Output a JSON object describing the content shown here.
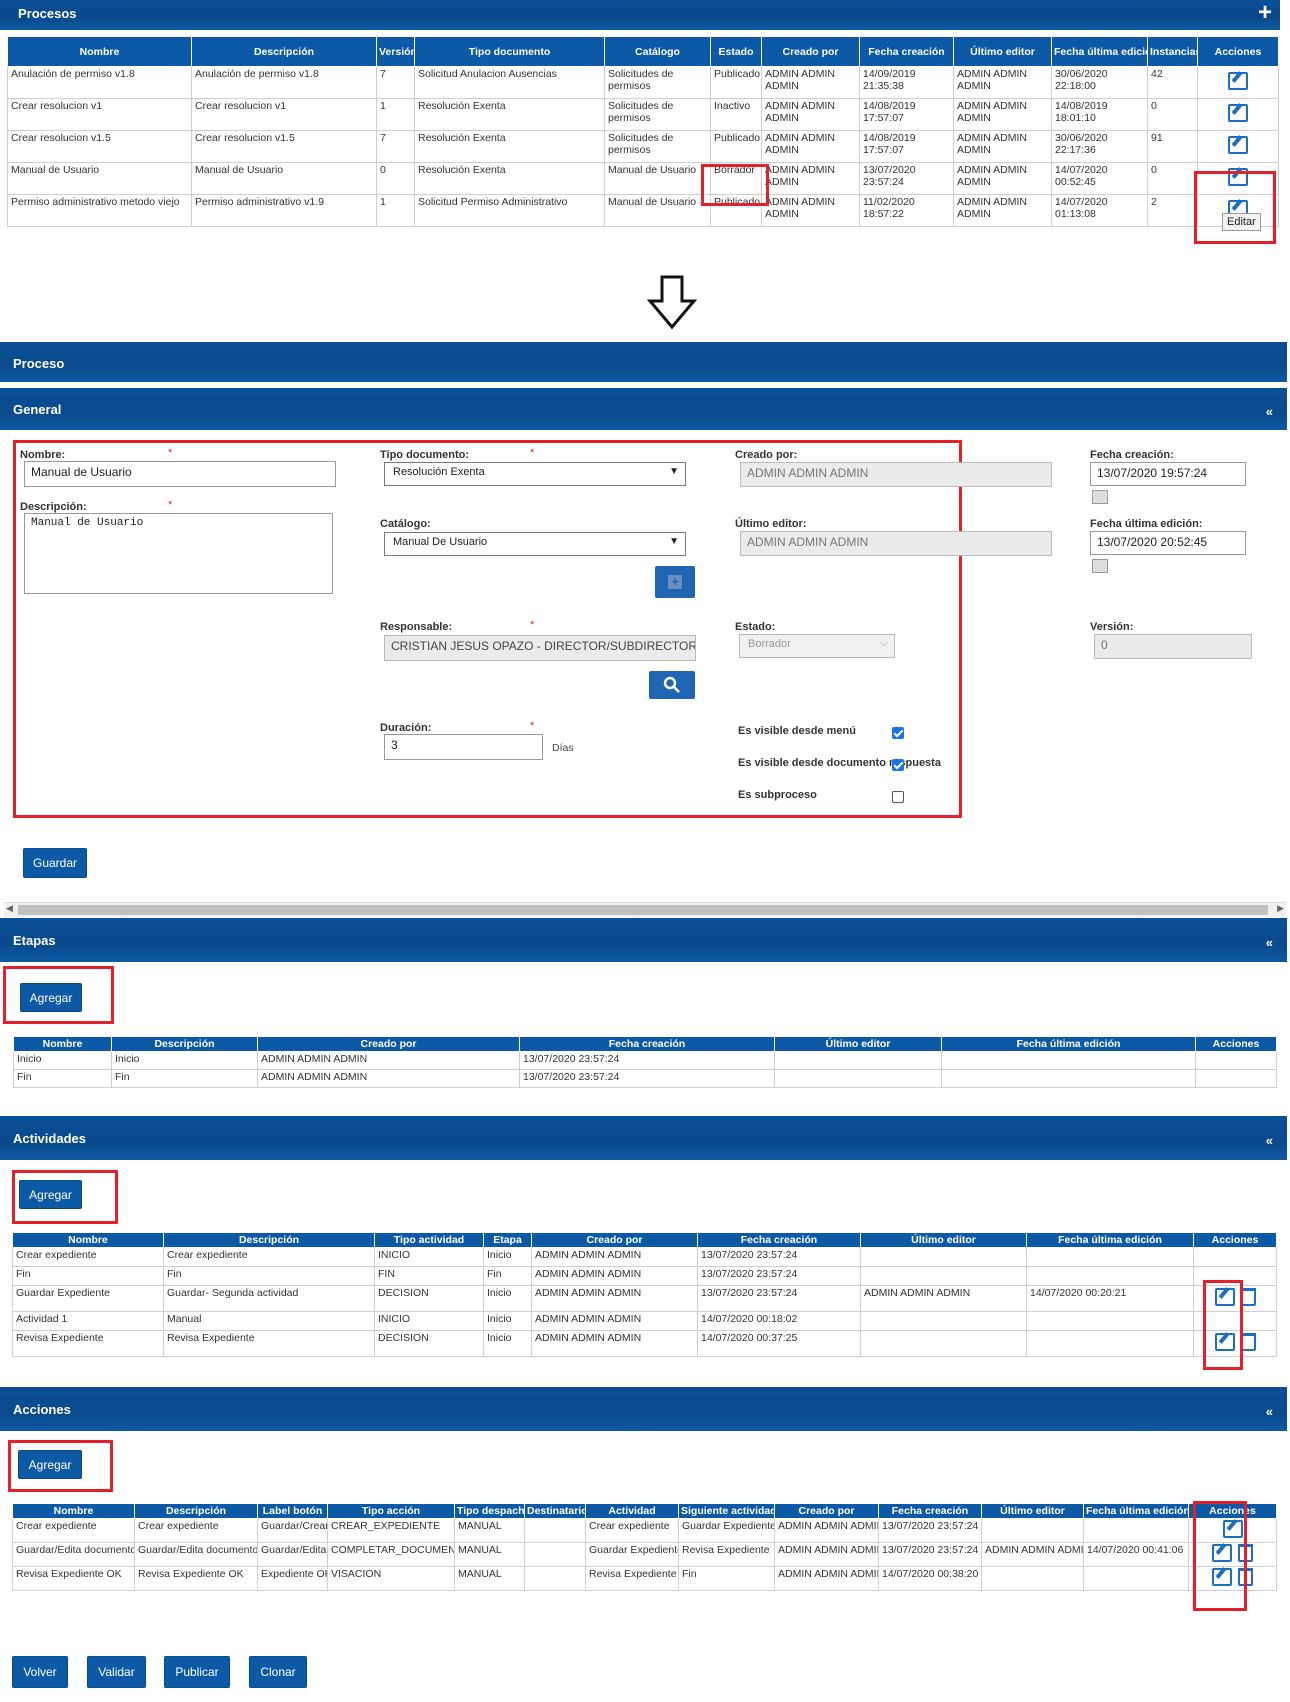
{
  "procesos": {
    "title": "Procesos",
    "add_icon": "plus-icon",
    "columns": [
      "Nombre",
      "Descripción",
      "Versión",
      "Tipo documento",
      "Catálogo",
      "Estado",
      "Creado por",
      "Fecha creación",
      "Último editor",
      "Fecha última edición",
      "Instancias",
      "Acciones"
    ],
    "rows": [
      [
        "Anulación de permiso v1.8",
        "Anulación de permiso v1.8",
        "7",
        "Solicitud Anulacion Ausencias",
        "Solicitudes de permisos",
        "Publicado",
        "ADMIN ADMIN ADMIN",
        "14/09/2019 21:35:38",
        "ADMIN ADMIN ADMIN",
        "30/06/2020 22:18:00",
        "42"
      ],
      [
        "Crear resolucion v1",
        "Crear resolucion v1",
        "1",
        "Resolución Exenta",
        "Solicitudes de permisos",
        "Inactivo",
        "ADMIN ADMIN ADMIN",
        "14/08/2019 17:57:07",
        "ADMIN ADMIN ADMIN",
        "14/08/2019 18:01:10",
        "0"
      ],
      [
        "Crear resolucion v1.5",
        "Crear resolucion v1.5",
        "7",
        "Resolución Exenta",
        "Solicitudes de permisos",
        "Publicado",
        "ADMIN ADMIN ADMIN",
        "14/08/2019 17:57:07",
        "ADMIN ADMIN ADMIN",
        "30/06/2020 22:17:36",
        "91"
      ],
      [
        "Manual de Usuario",
        "Manual de Usuario",
        "0",
        "Resolución Exenta",
        "Manual de Usuario",
        "Borrador",
        "ADMIN ADMIN ADMIN",
        "13/07/2020 23:57:24",
        "ADMIN ADMIN ADMIN",
        "14/07/2020 00:52:45",
        "0"
      ],
      [
        "Permiso administrativo metodo viejo",
        "Permiso administrativo v1.9",
        "1",
        "Solicitud Permiso Administrativo",
        "Manual de Usuario",
        "Publicado",
        "ADMIN ADMIN ADMIN",
        "11/02/2020 18:57:22",
        "ADMIN ADMIN ADMIN",
        "14/07/2020 01:13:08",
        "2"
      ]
    ],
    "tooltip": "Editar"
  },
  "proceso_title": "Proceso",
  "general": {
    "title": "General",
    "collapse": "«",
    "nombre_label": "Nombre:",
    "nombre_value": "Manual de Usuario",
    "descripcion_label": "Descripción:",
    "descripcion_value": "Manual de Usuario",
    "tipo_label": "Tipo documento:",
    "tipo_value": "Resolución Exenta",
    "catalogo_label": "Catálogo:",
    "catalogo_value": "Manual De Usuario",
    "responsable_label": "Responsable:",
    "responsable_value": "CRISTIAN JESUS OPAZO - DIRECTOR/SUBDIRECTOR",
    "duracion_label": "Duración:",
    "duracion_value": "3",
    "duracion_unit": "Días",
    "creado_label": "Creado por:",
    "creado_value": "ADMIN ADMIN ADMIN",
    "editor_label": "Último editor:",
    "editor_value": "ADMIN ADMIN ADMIN",
    "estado_label": "Estado:",
    "estado_value": "Borrador",
    "fecha_creacion_label": "Fecha creación:",
    "fecha_creacion_value": "13/07/2020 19:57:24",
    "fecha_edicion_label": "Fecha última edición:",
    "fecha_edicion_value": "13/07/2020 20:52:45",
    "version_label": "Versión:",
    "version_value": "0",
    "chk_menu_label": "Es visible desde menú",
    "chk_doc_label": "Es visible desde documento respuesta",
    "chk_sub_label": "Es subproceso",
    "chk_menu": true,
    "chk_doc": true,
    "chk_sub": false,
    "guardar": "Guardar",
    "required_mark": "*"
  },
  "etapas": {
    "title": "Etapas",
    "agregar": "Agregar",
    "columns": [
      "Nombre",
      "Descripción",
      "Creado por",
      "Fecha creación",
      "Último editor",
      "Fecha última edición",
      "Acciones"
    ],
    "rows": [
      [
        "Inicio",
        "Inicio",
        "ADMIN ADMIN ADMIN",
        "13/07/2020 23:57:24",
        "",
        "",
        ""
      ],
      [
        "Fin",
        "Fin",
        "ADMIN ADMIN ADMIN",
        "13/07/2020 23:57:24",
        "",
        "",
        ""
      ]
    ]
  },
  "actividades": {
    "title": "Actividades",
    "agregar": "Agregar",
    "columns": [
      "Nombre",
      "Descripción",
      "Tipo actividad",
      "Etapa",
      "Creado por",
      "Fecha creación",
      "Último editor",
      "Fecha última edición",
      "Acciones"
    ],
    "rows": [
      [
        "Crear expediente",
        "Crear expediente",
        "INICIO",
        "Inicio",
        "ADMIN ADMIN ADMIN",
        "13/07/2020 23:57:24",
        "",
        ""
      ],
      [
        "Fin",
        "Fin",
        "FIN",
        "Fin",
        "ADMIN ADMIN ADMIN",
        "13/07/2020 23:57:24",
        "",
        ""
      ],
      [
        "Guardar Expediente",
        "Guardar- Segunda actividad",
        "DECISION",
        "Inicio",
        "ADMIN ADMIN ADMIN",
        "13/07/2020 23:57:24",
        "ADMIN ADMIN ADMIN",
        "14/07/2020 00:20:21"
      ],
      [
        "Actividad 1",
        "Manual",
        "INICIO",
        "Inicio",
        "ADMIN ADMIN ADMIN",
        "14/07/2020 00:18:02",
        "",
        ""
      ],
      [
        "Revisa Expediente",
        "Revisa Expediente",
        "DECISION",
        "Inicio",
        "ADMIN ADMIN ADMIN",
        "14/07/2020 00:37:25",
        "",
        ""
      ]
    ]
  },
  "acciones": {
    "title": "Acciones",
    "agregar": "Agregar",
    "columns": [
      "Nombre",
      "Descripción",
      "Label botón",
      "Tipo acción",
      "Tipo despacho",
      "Destinatario",
      "Actividad",
      "Siguiente actividad",
      "Creado por",
      "Fecha creación",
      "Último editor",
      "Fecha última edición",
      "Acciones"
    ],
    "rows": [
      [
        "Crear expediente",
        "Crear expediente",
        "Guardar/Crear",
        "CREAR_EXPEDIENTE",
        "MANUAL",
        "",
        "Crear expediente",
        "Guardar Expediente",
        "ADMIN ADMIN ADMIN",
        "13/07/2020 23:57:24",
        "",
        ""
      ],
      [
        "Guardar/Edita documento",
        "Guardar/Edita documento",
        "Guardar/Editar",
        "COMPLETAR_DOCUMENTO",
        "MANUAL",
        "",
        "Guardar Expediente",
        "Revisa Expediente",
        "ADMIN ADMIN ADMIN",
        "13/07/2020 23:57:24",
        "ADMIN ADMIN ADMIN",
        "14/07/2020 00:41:06"
      ],
      [
        "Revisa Expediente OK",
        "Revisa Expediente OK",
        "Expediente OK",
        "VISACION",
        "MANUAL",
        "",
        "Revisa Expediente",
        "Fin",
        "ADMIN ADMIN ADMIN",
        "14/07/2020 00:38:20",
        "",
        ""
      ]
    ]
  },
  "footer": {
    "volver": "Volver",
    "validar": "Validar",
    "publicar": "Publicar",
    "clonar": "Clonar"
  },
  "colors": {
    "header": "#0b4f96",
    "highlight": "#e4202a",
    "button": "#0c5aa6"
  }
}
